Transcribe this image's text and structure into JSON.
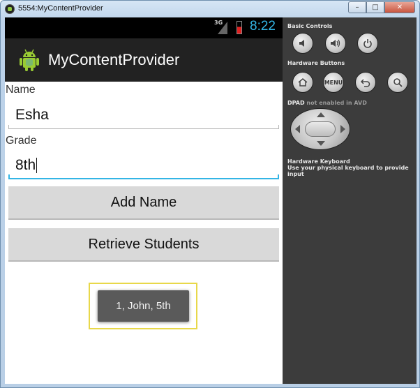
{
  "window": {
    "title": "5554:MyContentProvider",
    "minimize_glyph": "–",
    "maximize_glyph": "□",
    "close_glyph": "✕"
  },
  "status_bar": {
    "network": "3G",
    "time": "8:22",
    "time_color": "#33b5e5"
  },
  "action_bar": {
    "title": "MyContentProvider",
    "icon": "android-robot-icon"
  },
  "form": {
    "name_label": "Name",
    "name_value": "Esha",
    "grade_label": "Grade",
    "grade_value": "8th"
  },
  "buttons": {
    "add": "Add Name",
    "retrieve": "Retrieve Students"
  },
  "toast": {
    "text": "1, John, 5th"
  },
  "controls": {
    "basic_title": "Basic Controls",
    "basic_buttons": [
      "volume-down-icon",
      "volume-up-icon",
      "power-icon"
    ],
    "hardware_title": "Hardware Buttons",
    "hardware_buttons": [
      "home-icon",
      "menu",
      "back-icon",
      "search-icon"
    ],
    "menu_label": "MENU",
    "dpad_title": "DPAD",
    "dpad_note": "not enabled in AVD",
    "keyboard_title": "Hardware Keyboard",
    "keyboard_note": "Use your physical keyboard to provide input"
  }
}
